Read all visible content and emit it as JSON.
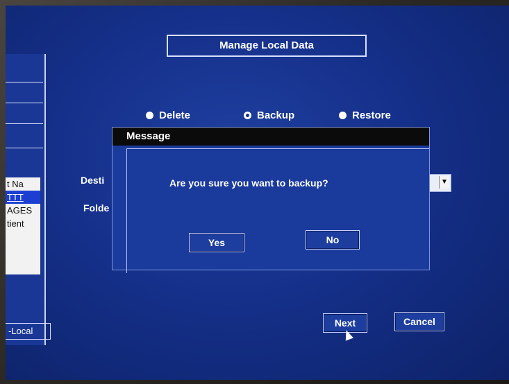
{
  "window": {
    "title": "Manage Local Data"
  },
  "modes": [
    {
      "label": "Delete",
      "selected": false
    },
    {
      "label": "Backup",
      "selected": true
    },
    {
      "label": "Restore",
      "selected": false
    }
  ],
  "form": {
    "destination_label_partial": "Desti",
    "folder_label_partial": "Folde"
  },
  "left_list": {
    "items": [
      "t Na",
      "TTT",
      "AGES",
      "tient"
    ]
  },
  "left_tab": {
    "label": "-Local"
  },
  "dialog": {
    "title": "Message",
    "text": "Are you sure you want to backup?",
    "yes_label": "Yes",
    "no_label": "No"
  },
  "footer": {
    "next_label": "Next",
    "cancel_label": "Cancel"
  },
  "colors": {
    "screen_blue": "#15308a",
    "dialog_header": "#0b0b0b"
  }
}
